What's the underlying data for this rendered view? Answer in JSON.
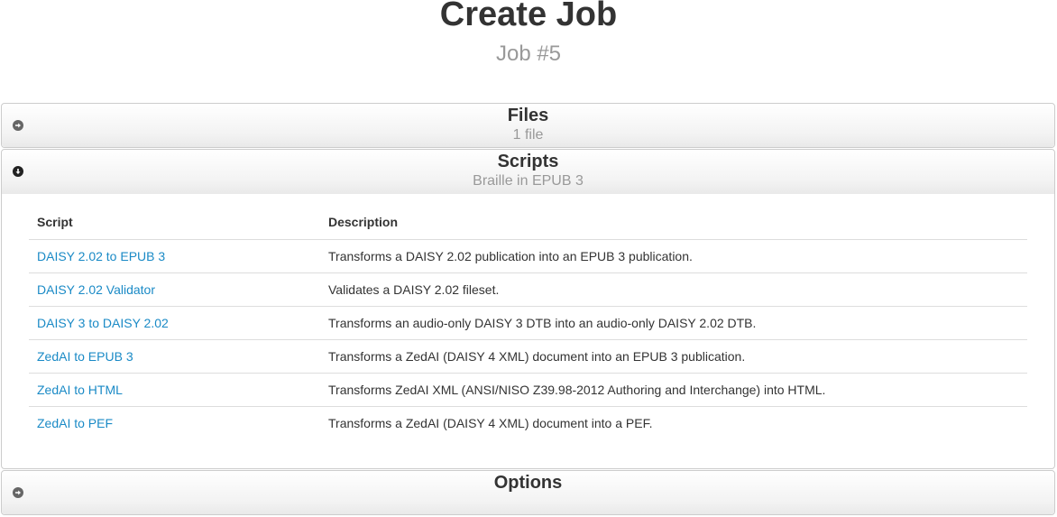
{
  "header": {
    "title": "Create Job",
    "subtitle": "Job #5"
  },
  "sections": {
    "files": {
      "title": "Files",
      "summary": "1 file",
      "toggle_icon": "arrow-right-circle-icon"
    },
    "scripts": {
      "title": "Scripts",
      "summary": "Braille in EPUB 3",
      "toggle_icon": "arrow-down-circle-icon",
      "table": {
        "headers": [
          "Script",
          "Description"
        ],
        "rows": [
          {
            "script": "DAISY 2.02 to EPUB 3",
            "description": "Transforms a DAISY 2.02 publication into an EPUB 3 publication."
          },
          {
            "script": "DAISY 2.02 Validator",
            "description": "Validates a DAISY 2.02 fileset."
          },
          {
            "script": "DAISY 3 to DAISY 2.02",
            "description": "Transforms an audio-only DAISY 3 DTB into an audio-only DAISY 2.02 DTB."
          },
          {
            "script": "ZedAI to EPUB 3",
            "description": "Transforms a ZedAI (DAISY 4 XML) document into an EPUB 3 publication."
          },
          {
            "script": "ZedAI to HTML",
            "description": "Transforms ZedAI XML (ANSI/NISO Z39.98-2012 Authoring and Interchange) into HTML."
          },
          {
            "script": "ZedAI to PEF",
            "description": "Transforms a ZedAI (DAISY 4 XML) document into a PEF."
          }
        ]
      }
    },
    "options": {
      "title": "Options",
      "summary": "",
      "toggle_icon": "arrow-right-circle-icon"
    }
  },
  "colors": {
    "link": "#1a8ac6",
    "muted": "#999999",
    "text": "#333333",
    "border": "#cccccc"
  }
}
